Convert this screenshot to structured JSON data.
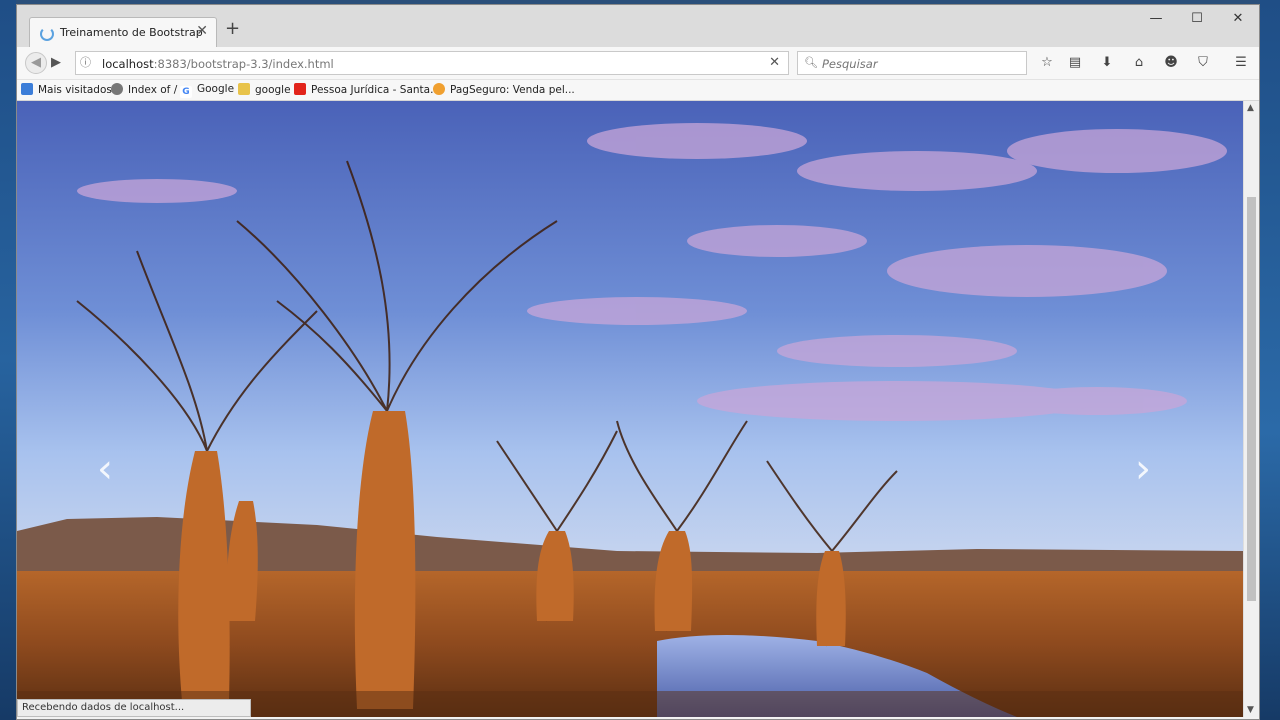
{
  "browser": {
    "tab_title": "Treinamento de Bootstrap",
    "tab_close": "✕",
    "new_tab": "+",
    "url_host": "localhost",
    "url_rest": ":8383/bootstrap-3.3/index.html",
    "search_placeholder": "Pesquisar",
    "stop_icon": "✕"
  },
  "window_controls": {
    "minimize": "—",
    "maximize": "☐",
    "close": "✕"
  },
  "bookmarks": [
    {
      "label": "Mais visitados",
      "icon": "bookmark-icon",
      "color": "#3b7dd8"
    },
    {
      "label": "Index of /",
      "icon": "globe-icon",
      "color": "#777777"
    },
    {
      "label": "Google",
      "icon": "google-icon",
      "color": "#4285f4"
    },
    {
      "label": "google",
      "icon": "folder-icon",
      "color": "#e8c34a"
    },
    {
      "label": "Pessoa Jurídica - Santa...",
      "icon": "santander-icon",
      "color": "#e2231a"
    },
    {
      "label": "PagSeguro: Venda pel...",
      "icon": "pagseguro-icon",
      "color": "#f0a030"
    }
  ],
  "carousel": {
    "prev_icon": "‹",
    "next_icon": "›"
  },
  "status_text": "Recebendo dados de localhost...",
  "scrollbar": {
    "up": "▲",
    "down": "▼"
  }
}
